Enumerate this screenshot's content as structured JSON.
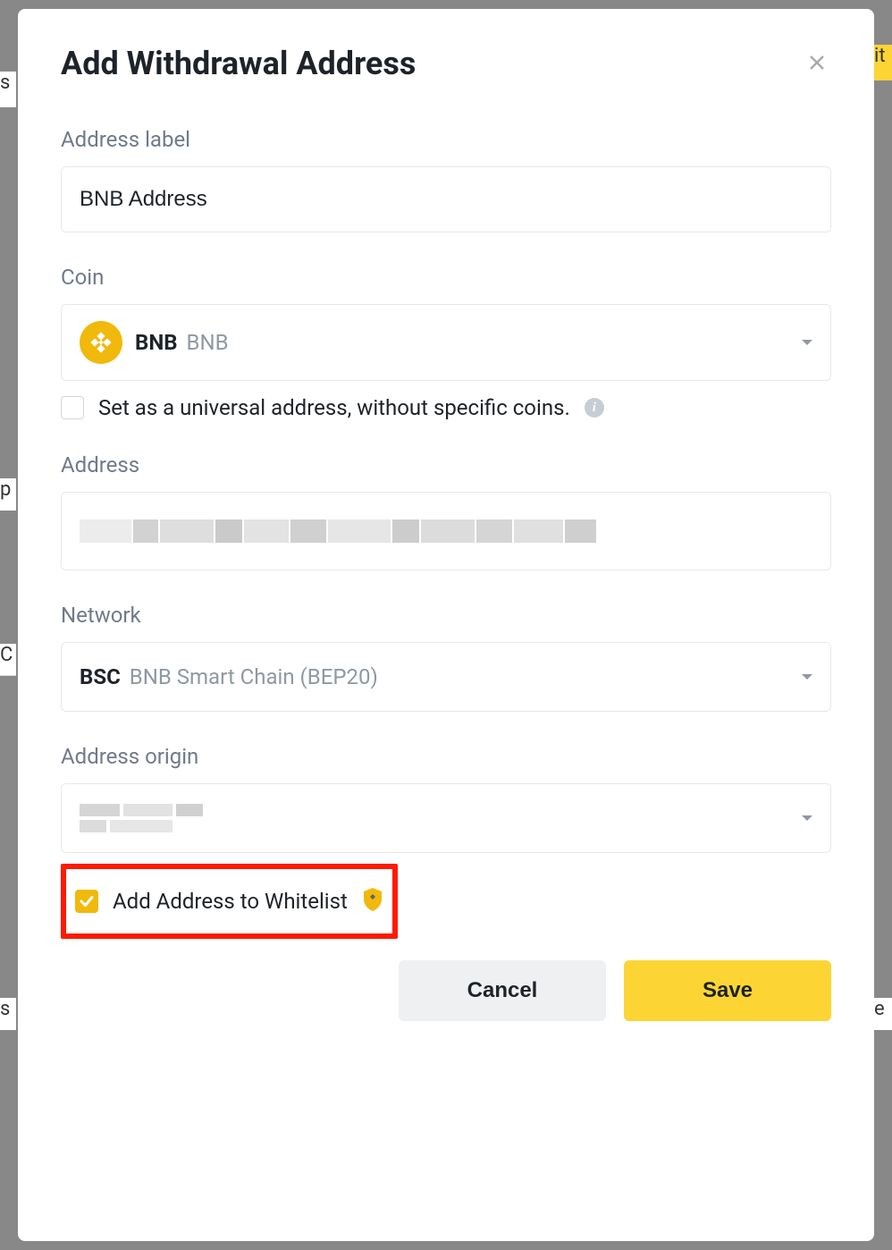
{
  "modal": {
    "title": "Add Withdrawal Address",
    "address_label": {
      "label": "Address label",
      "value": "BNB Address"
    },
    "coin": {
      "label": "Coin",
      "selected_symbol": "BNB",
      "selected_name": "BNB"
    },
    "universal_checkbox": {
      "label": "Set as a universal address, without specific coins.",
      "checked": false
    },
    "address": {
      "label": "Address",
      "value_redacted": true
    },
    "network": {
      "label": "Network",
      "selected_symbol": "BSC",
      "selected_name": "BNB Smart Chain (BEP20)"
    },
    "address_origin": {
      "label": "Address origin",
      "value_redacted": true
    },
    "whitelist_checkbox": {
      "label": "Add Address to Whitelist",
      "checked": true
    },
    "buttons": {
      "cancel": "Cancel",
      "save": "Save"
    }
  }
}
